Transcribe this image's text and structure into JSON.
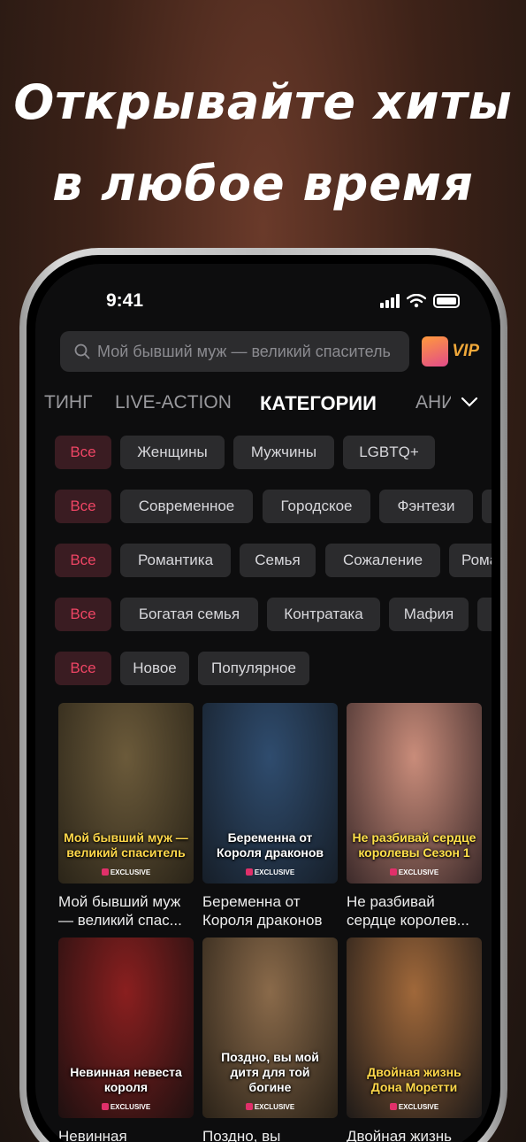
{
  "headline": {
    "line1": "Открывайте хиты",
    "line2": "в любое время"
  },
  "status_bar": {
    "time": "9:41"
  },
  "search": {
    "placeholder": "Мой бывший муж — великий спаситель"
  },
  "vip": {
    "label": "VIP"
  },
  "tabs": [
    {
      "label": "ТИНГ"
    },
    {
      "label": "LIVE-ACTION"
    },
    {
      "label": "КАТЕГОРИИ",
      "active": true
    },
    {
      "label": "АНИ"
    }
  ],
  "chip_rows": [
    [
      "Все",
      "Женщины",
      "Мужчины",
      "LGBTQ+"
    ],
    [
      "Все",
      "Современное",
      "Городское",
      "Фэнтези"
    ],
    [
      "Все",
      "Романтика",
      "Семья",
      "Сожаление",
      "Рома"
    ],
    [
      "Все",
      "Богатая семья",
      "Контратака",
      "Мафия"
    ],
    [
      "Все",
      "Новое",
      "Популярное"
    ]
  ],
  "cards": [
    {
      "caption": "Мой бывший муж — великий спас...",
      "poster_title": "Мой бывший муж — великий спаситель",
      "badge": "EXCLUSIVE",
      "bg": [
        "#6b5a3a",
        "#2a2418"
      ],
      "title_color": "#ffd84a"
    },
    {
      "caption": "Беременна от Короля драконов",
      "poster_title": "Беременна от Короля драконов",
      "badge": "EXCLUSIVE",
      "bg": [
        "#2f4c6e",
        "#161e28"
      ],
      "title_color": "#ffffff"
    },
    {
      "caption": "Не разбивай сердце королев...",
      "poster_title": "Не разбивай сердце королевы Сезон 1",
      "badge": "EXCLUSIVE",
      "bg": [
        "#c98c7a",
        "#3c2a2a"
      ],
      "title_color": "#ffe14a"
    },
    {
      "caption": "Невинная",
      "poster_title": "Невинная невеста короля",
      "badge": "EXCLUSIVE",
      "bg": [
        "#8a1f1f",
        "#1e1010"
      ],
      "title_color": "#ffffff"
    },
    {
      "caption": "Поздно, вы",
      "poster_title": "Поздно, вы мой дитя для той богине",
      "badge": "EXCLUSIVE",
      "bg": [
        "#8a6a4a",
        "#2a2218"
      ],
      "title_color": "#ffffff"
    },
    {
      "caption": "Двойная жизнь",
      "poster_title": "Двойная жизнь Дона Моретти",
      "badge": "EXCLUSIVE",
      "bg": [
        "#a0683a",
        "#1e1a18"
      ],
      "title_color": "#ffd84a"
    }
  ],
  "colors": {
    "accent": "#ee4564",
    "chip_selected_bg": "#3a1c22",
    "chip_bg": "#2b2b2d",
    "vip": "#f0a83a"
  }
}
